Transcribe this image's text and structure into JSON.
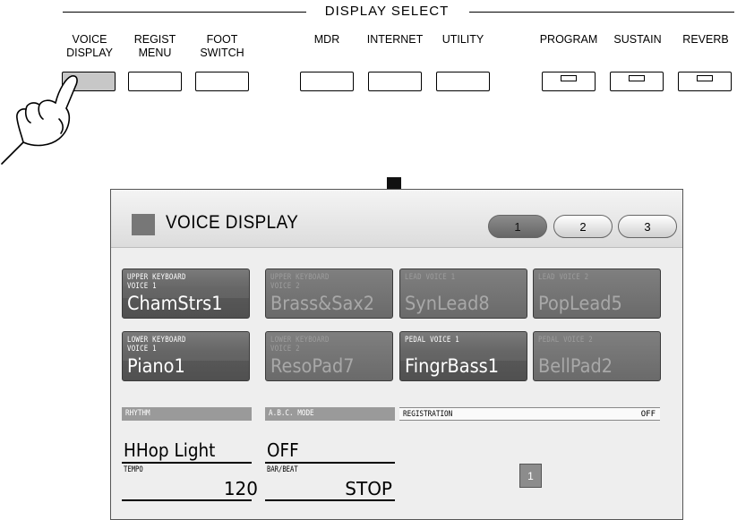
{
  "panel": {
    "display_select_label": "DISPLAY SELECT",
    "buttons": [
      {
        "label_line1": "VOICE",
        "label_line2": "DISPLAY"
      },
      {
        "label_line1": "REGIST",
        "label_line2": "MENU"
      },
      {
        "label_line1": "FOOT",
        "label_line2": "SWITCH"
      },
      {
        "label_line1": "MDR",
        "label_line2": ""
      },
      {
        "label_line1": "INTERNET",
        "label_line2": ""
      },
      {
        "label_line1": "UTILITY",
        "label_line2": ""
      },
      {
        "label_line1": "PROGRAM",
        "label_line2": ""
      },
      {
        "label_line1": "SUSTAIN",
        "label_line2": ""
      },
      {
        "label_line1": "REVERB",
        "label_line2": ""
      }
    ]
  },
  "screen": {
    "title": "VOICE DISPLAY",
    "pages": [
      "1",
      "2",
      "3"
    ],
    "active_page": "1",
    "voices": [
      {
        "label": "UPPER KEYBOARD\nVOICE 1",
        "name": "ChamStrs1",
        "on": true
      },
      {
        "label": "UPPER KEYBOARD\nVOICE 2",
        "name": "Brass&Sax2",
        "on": false
      },
      {
        "label": "LEAD VOICE 1",
        "name": "SynLead8",
        "on": false
      },
      {
        "label": "LEAD VOICE 2",
        "name": "PopLead5",
        "on": false
      },
      {
        "label": "LOWER KEYBOARD\nVOICE 1",
        "name": "Piano1",
        "on": true
      },
      {
        "label": "LOWER KEYBOARD\nVOICE 2",
        "name": "ResoPad7",
        "on": false
      },
      {
        "label": "PEDAL VOICE 1",
        "name": "FingrBass1",
        "on": true
      },
      {
        "label": "PEDAL VOICE 2",
        "name": "BellPad2",
        "on": false
      }
    ],
    "rhythm": {
      "label": "RHYTHM",
      "value": "HHop Light"
    },
    "abc": {
      "label": "A.B.C. MODE",
      "value": "OFF"
    },
    "registration": {
      "label": "REGISTRATION",
      "status": "OFF",
      "button": "1"
    },
    "tempo": {
      "label": "TEMPO",
      "value": "120"
    },
    "barbeat": {
      "label": "BAR/BEAT",
      "value": "STOP"
    }
  },
  "colors": {
    "screen_bg": "#eeeeee",
    "voice_on": "#666666",
    "voice_off": "#707070",
    "panel_pressed": "#c7c7c7"
  },
  "icons": [
    "hand-pointer-icon",
    "down-arrow-icon"
  ]
}
